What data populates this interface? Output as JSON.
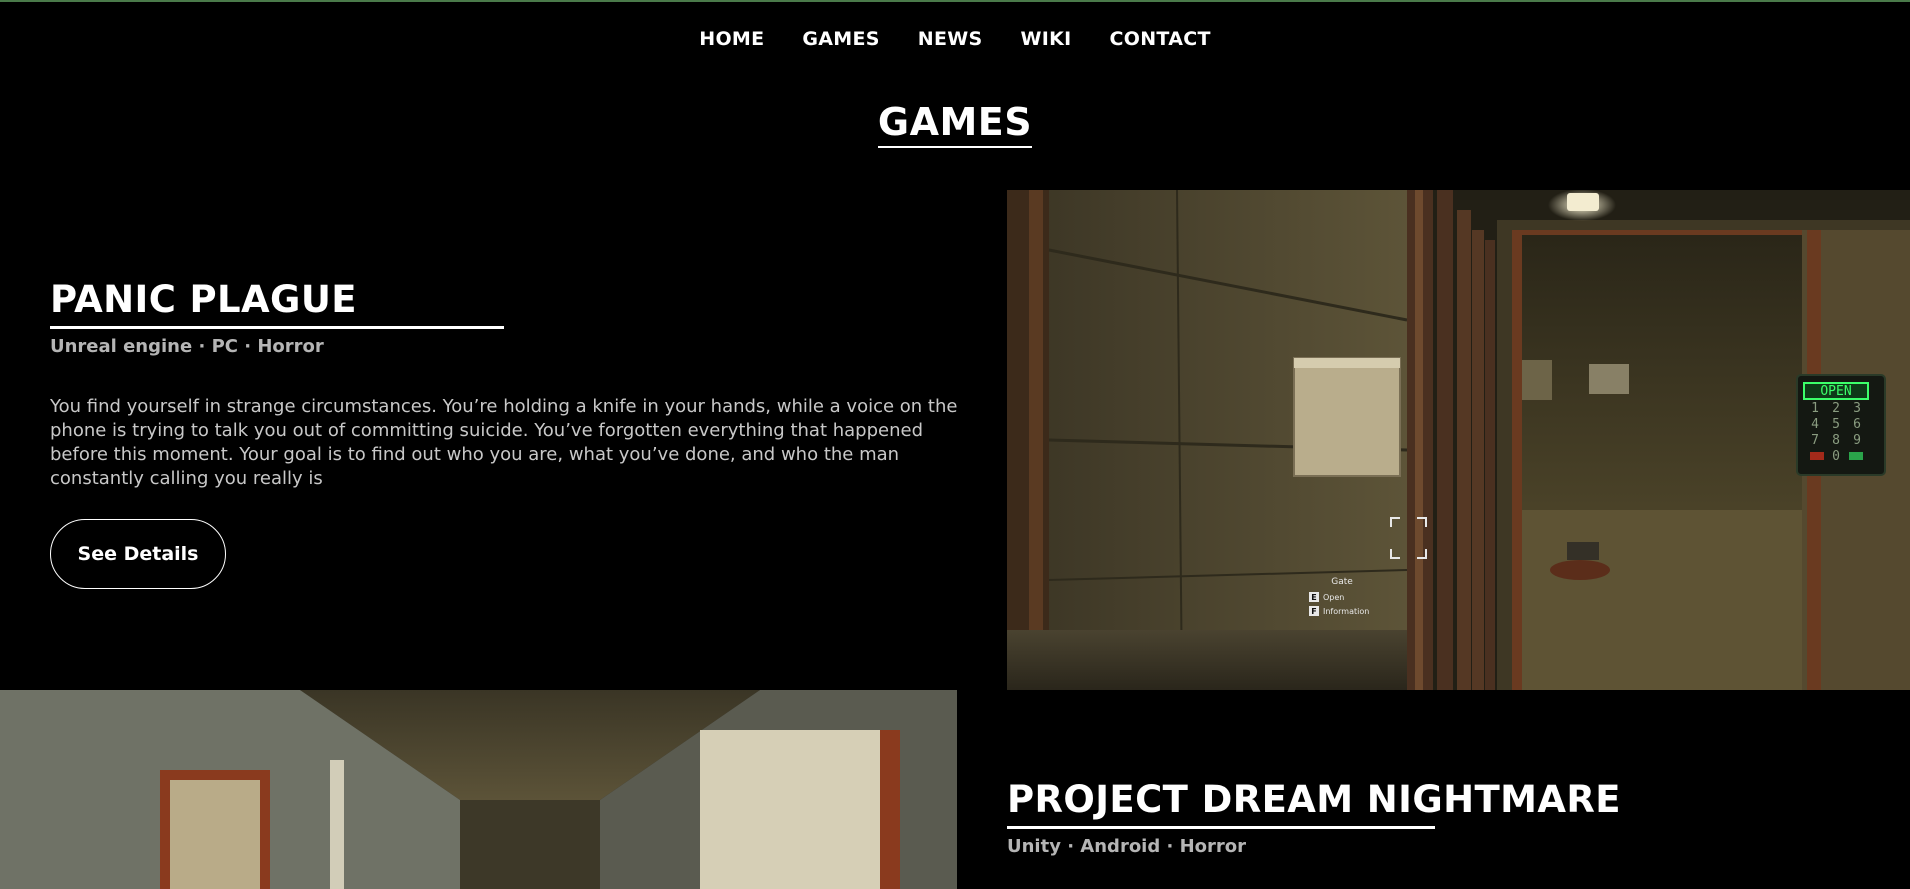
{
  "nav": {
    "items": [
      "HOME",
      "GAMES",
      "NEWS",
      "WIKI",
      "CONTACT"
    ]
  },
  "section": {
    "title": "GAMES"
  },
  "games": [
    {
      "title": "PANIC PLAGUE",
      "meta": "Unreal engine · PC · Horror",
      "description": "You find yourself in strange circumstances. You’re holding a knife in your hands, while a voice on the phone is trying to talk you out of committing suicide. You’ve forgotten everything that happened before this moment. Your goal is to find out who you are, what you’ve done, and who the man constantly calling you really is",
      "button_label": "See Details",
      "screenshot": {
        "keypad_display": "OPEN",
        "keypad_keys": [
          "1",
          "2",
          "3",
          "4",
          "5",
          "6",
          "7",
          "8",
          "9",
          "0"
        ],
        "prompt_title": "Gate",
        "prompt_actions": [
          {
            "key": "E",
            "label": "Open"
          },
          {
            "key": "F",
            "label": "Information"
          }
        ]
      }
    },
    {
      "title": "PROJECT DREAM NIGHTMARE",
      "meta": "Unity · Android · Horror"
    }
  ],
  "colors": {
    "background": "#000000",
    "text": "#ffffff",
    "meta_text": "#b5b5b5",
    "body_text": "#c8c8c8",
    "accent_line": "#4a7a4a",
    "keypad_green": "#3cff6a"
  }
}
